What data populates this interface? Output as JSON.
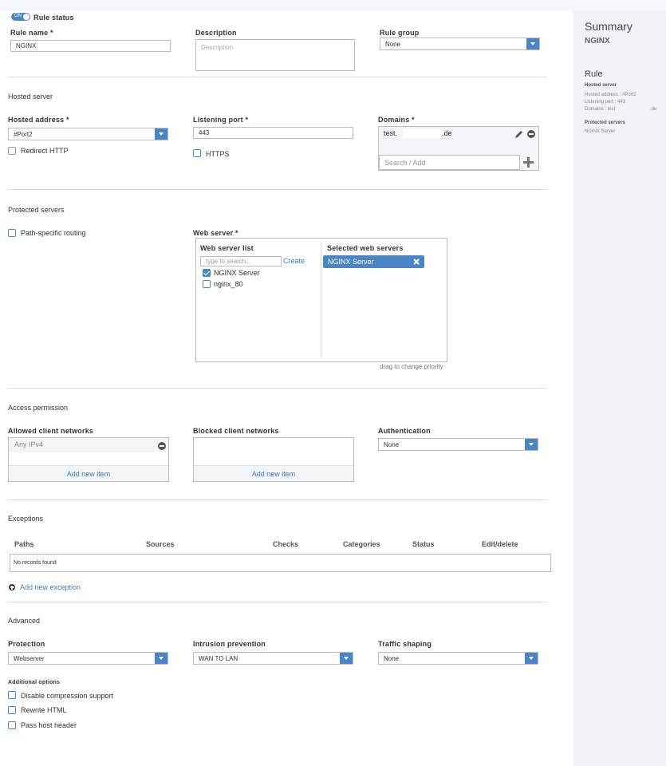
{
  "rule": {
    "status_toggle": "ON",
    "status_label": "Rule status",
    "name_label": "Rule name *",
    "name_value": "NGINX",
    "description_label": "Description",
    "description_placeholder": "Description",
    "group_label": "Rule group",
    "group_value": "None"
  },
  "hosted": {
    "title": "Hosted server",
    "address_label": "Hosted address *",
    "address_value": "#Port2",
    "redirect_http": "Redirect HTTP",
    "port_label": "Listening port *",
    "port_value": "443",
    "https_label": "HTTPS",
    "domains_label": "Domains *",
    "domain_prefix": "test.",
    "domain_suffix": ".de",
    "domains_placeholder": "Search / Add"
  },
  "protected": {
    "title": "Protected servers",
    "path_routing": "Path-specific routing",
    "web_server_label": "Web server *",
    "list_header": "Web server list",
    "search_placeholder": "type to search...",
    "create_link": "Create",
    "servers": [
      {
        "name": "NGINX Server",
        "checked": true
      },
      {
        "name": "nginx_80",
        "checked": false
      }
    ],
    "selected_header": "Selected web servers",
    "selected": [
      "NGINX Server"
    ],
    "drag_hint": "drag to change priority"
  },
  "access": {
    "title": "Access permission",
    "allowed_label": "Allowed client networks",
    "allowed_items": [
      "Any IPv4"
    ],
    "add_new_item": "Add new item",
    "blocked_label": "Blocked client networks",
    "blocked_add": "Add new item",
    "auth_label": "Authentication",
    "auth_value": "None"
  },
  "exceptions": {
    "title": "Exceptions",
    "columns": [
      "Paths",
      "Sources",
      "Checks",
      "Categories",
      "Status",
      "Edit/delete"
    ],
    "empty_text": "No records found",
    "add_link": "Add new exception"
  },
  "advanced": {
    "title": "Advanced",
    "protection_label": "Protection",
    "protection_value": "Webserver",
    "ips_label": "Intrusion prevention",
    "ips_value": "WAN TO LAN",
    "shaping_label": "Traffic shaping",
    "shaping_value": "None",
    "additional_label": "Additional options",
    "options": [
      "Disable compression support",
      "Rewrite HTML",
      "Pass host header"
    ]
  },
  "summary": {
    "title": "Summary",
    "rule_name": "NGINX",
    "rule_heading": "Rule",
    "hosted_heading": "Hosted server",
    "hosted_address": "Hosted address : #Port2",
    "listening_port": "Listening port : 443",
    "domains": "Domains : test",
    "domains_suffix": ".de",
    "protected_heading": "Protected servers",
    "protected_item": "NGINX Server"
  },
  "colors": {
    "accent": "#4a86c5",
    "sidebar_bg": "#f2f3f5",
    "border": "#bcbcbc"
  }
}
